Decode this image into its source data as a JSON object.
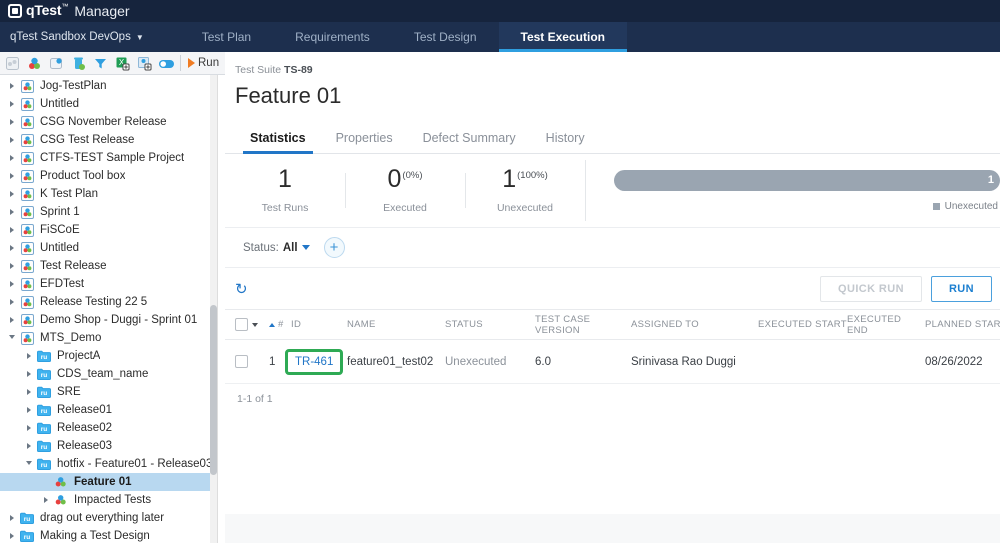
{
  "brand": {
    "name": "qTest",
    "tm": "™",
    "product": "Manager",
    "logo_icon": "qtest-logo-icon"
  },
  "nav": {
    "project": "qTest Sandbox DevOps",
    "project_caret_icon": "chevron-down-icon",
    "tabs": [
      {
        "label": "Test Plan",
        "active": false
      },
      {
        "label": "Requirements",
        "active": false
      },
      {
        "label": "Test Design",
        "active": false
      },
      {
        "label": "Test Execution",
        "active": true
      }
    ]
  },
  "toolbar": {
    "items": [
      {
        "icon": "new-release-icon",
        "label": "New Release"
      },
      {
        "icon": "new-test-suite-icon",
        "label": "New Test Suite"
      },
      {
        "icon": "new-test-cycle-icon",
        "label": "New Test Cycle"
      },
      {
        "icon": "delete-icon",
        "label": "Delete"
      },
      {
        "icon": "filter-icon",
        "label": "Filter"
      },
      {
        "icon": "export-excel-icon",
        "label": "Export to Excel"
      },
      {
        "icon": "import-icon",
        "label": "Import"
      },
      {
        "icon": "toggle-icon",
        "label": "Toggle"
      }
    ],
    "run_label": "Run",
    "run_icon": "play-icon"
  },
  "sidebar": {
    "scrollbar_icon": "vertical-scrollbar",
    "nodes": [
      {
        "label": "Jog-TestPlan",
        "indent": 0,
        "icon": "release-icon",
        "state": "collapsed",
        "selected": false
      },
      {
        "label": "Untitled",
        "indent": 0,
        "icon": "release-icon",
        "state": "collapsed",
        "selected": false
      },
      {
        "label": "CSG November Release",
        "indent": 0,
        "icon": "release-icon",
        "state": "collapsed",
        "selected": false
      },
      {
        "label": "CSG Test Release",
        "indent": 0,
        "icon": "release-icon",
        "state": "collapsed",
        "selected": false
      },
      {
        "label": "CTFS-TEST Sample Project",
        "indent": 0,
        "icon": "release-icon",
        "state": "collapsed",
        "selected": false
      },
      {
        "label": "Product Tool box",
        "indent": 0,
        "icon": "release-icon",
        "state": "collapsed",
        "selected": false
      },
      {
        "label": "K Test Plan",
        "indent": 0,
        "icon": "release-icon",
        "state": "collapsed",
        "selected": false
      },
      {
        "label": "Sprint 1",
        "indent": 0,
        "icon": "release-icon",
        "state": "collapsed",
        "selected": false
      },
      {
        "label": "FiSCoE",
        "indent": 0,
        "icon": "release-icon",
        "state": "collapsed",
        "selected": false
      },
      {
        "label": "Untitled",
        "indent": 0,
        "icon": "release-icon",
        "state": "collapsed",
        "selected": false
      },
      {
        "label": "Test Release",
        "indent": 0,
        "icon": "release-icon",
        "state": "collapsed",
        "selected": false
      },
      {
        "label": "EFDTest",
        "indent": 0,
        "icon": "release-icon",
        "state": "collapsed",
        "selected": false
      },
      {
        "label": "Release Testing 22 5",
        "indent": 0,
        "icon": "release-icon",
        "state": "collapsed",
        "selected": false
      },
      {
        "label": "Demo Shop - Duggi - Sprint 01",
        "indent": 0,
        "icon": "release-icon",
        "state": "collapsed",
        "selected": false
      },
      {
        "label": "MTS_Demo",
        "indent": 0,
        "icon": "release-icon",
        "state": "expanded",
        "selected": false
      },
      {
        "label": "ProjectA",
        "indent": 1,
        "icon": "test-cycle-icon",
        "state": "collapsed",
        "selected": false
      },
      {
        "label": "CDS_team_name",
        "indent": 1,
        "icon": "test-cycle-icon",
        "state": "collapsed",
        "selected": false
      },
      {
        "label": "SRE",
        "indent": 1,
        "icon": "test-cycle-icon",
        "state": "collapsed",
        "selected": false
      },
      {
        "label": "Release01",
        "indent": 1,
        "icon": "test-cycle-icon",
        "state": "collapsed",
        "selected": false
      },
      {
        "label": "Release02",
        "indent": 1,
        "icon": "test-cycle-icon",
        "state": "collapsed",
        "selected": false
      },
      {
        "label": "Release03",
        "indent": 1,
        "icon": "test-cycle-icon",
        "state": "collapsed",
        "selected": false
      },
      {
        "label": "hotfix - Feature01 - Release03",
        "indent": 1,
        "icon": "test-cycle-icon",
        "state": "expanded",
        "selected": false
      },
      {
        "label": "Feature 01",
        "indent": 2,
        "icon": "test-suite-icon",
        "state": "leaf",
        "selected": true
      },
      {
        "label": "Impacted Tests",
        "indent": 2,
        "icon": "test-suite-icon",
        "state": "collapsed",
        "selected": false
      },
      {
        "label": "drag out everything later",
        "indent": 0,
        "icon": "test-cycle-icon",
        "state": "collapsed",
        "selected": false
      },
      {
        "label": "Making a Test Design",
        "indent": 0,
        "icon": "test-cycle-icon",
        "state": "collapsed",
        "selected": false
      }
    ]
  },
  "main": {
    "breadcrumb_prefix": "Test Suite ",
    "breadcrumb_id": "TS-89",
    "title": "Feature 01",
    "tabs": [
      {
        "label": "Statistics",
        "active": true
      },
      {
        "label": "Properties",
        "active": false
      },
      {
        "label": "Defect Summary",
        "active": false
      },
      {
        "label": "History",
        "active": false
      }
    ],
    "stats": [
      {
        "value": "1",
        "pct": "",
        "label": "Test Runs"
      },
      {
        "value": "0",
        "pct": "(0%)",
        "label": "Executed"
      },
      {
        "value": "1",
        "pct": "(100%)",
        "label": "Unexecuted"
      }
    ],
    "progress": {
      "value": "1",
      "percent": 100,
      "color": "#9aa5b1"
    },
    "legend": [
      {
        "label": "Unexecuted",
        "color": "#9aa5b1"
      }
    ],
    "filter": {
      "status_label": "Status:",
      "status_value": "All",
      "caret_icon": "chevron-down-icon",
      "add_icon": "plus-icon"
    },
    "actions": {
      "refresh_icon": "refresh-icon",
      "quick_run_label": "QUICK RUN",
      "run_label": "RUN"
    },
    "table": {
      "columns": [
        "#",
        "ID",
        "NAME",
        "STATUS",
        "TEST CASE VERSION",
        "ASSIGNED TO",
        "EXECUTED START",
        "EXECUTED END",
        "PLANNED START"
      ],
      "rows": [
        {
          "num": "1",
          "id": "TR-461",
          "name": "feature01_test02",
          "status": "Unexecuted",
          "version": "6.0",
          "assigned_to": "Srinivasa Rao Duggi",
          "executed_start": "",
          "executed_end": "",
          "planned_start": "08/26/2022",
          "highlighted": true
        }
      ],
      "highlight_color": "#2eaa54",
      "pager": "1-1 of 1"
    }
  }
}
